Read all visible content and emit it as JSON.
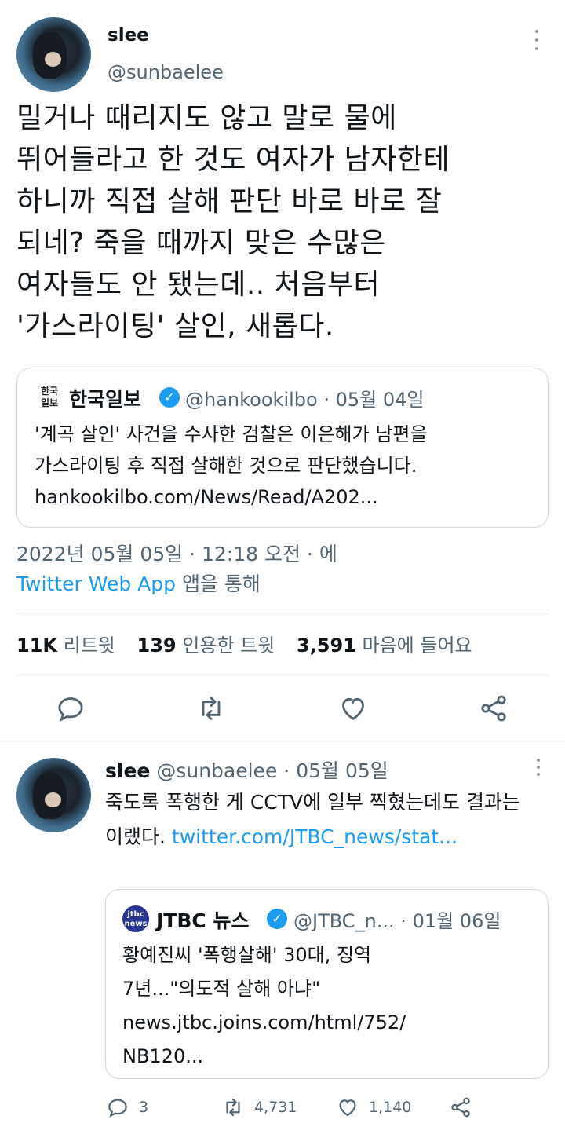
{
  "main_tweet": {
    "author_name": "slee",
    "author_handle": "@sunbaelee",
    "text": "밀거나 때리지도 않고 말로 물에\n뛰어들라고 한 것도 여자가 남자한테\n하니까 직접 살해 판단 바로 바로 잘\n되네? 죽을 때까지 맞은 수많은\n여자들도 안 됐는데.. 처음부터\n'가스라이팅' 살인, 새롭다.",
    "quoted": {
      "logo_text": "한국\n일보",
      "name": "한국일보",
      "handle": "@hankookilbo",
      "date": "05월 04일",
      "separator": "·",
      "text": "'계곡 살인' 사건을 수사한 검찰은 이은해가 남편을\n가스라이팅 후 직접 살해한 것으로 판단했습니다.\nhankookilbo.com/News/Read/A202..."
    },
    "timestamp": "2022년 05월 05일 · 12:18 오전 · 에",
    "source_link": "Twitter Web App",
    "source_suffix": " 앱을 통해",
    "stats": {
      "retweets_count": "11K",
      "retweets_label": "리트윗",
      "quotes_count": "139",
      "quotes_label": "인용한 트윗",
      "likes_count": "3,591",
      "likes_label": "마음에 들어요"
    }
  },
  "reply_tweet": {
    "author_name": "slee",
    "author_handle": "@sunbaelee",
    "separator": "·",
    "date": "05월 05일",
    "text": "죽도록 폭행한 게 CCTV에 일부 찍혔는데도 결과는 이랬다. ",
    "link": "twitter.com/JTBC_news/stat...",
    "quoted": {
      "logo_text": "jtbc news",
      "name": "JTBC 뉴스",
      "handle": "@JTBC_n...",
      "date": "01월 06일",
      "separator": "·",
      "text": "황예진씨 '폭행살해' 30대, 징역\n7년...\"의도적 살해 아냐\"\nnews.jtbc.joins.com/html/752/\nNB120..."
    },
    "counts": {
      "replies": "3",
      "retweets": "4,731",
      "likes": "1,140"
    }
  },
  "colors": {
    "accent": "#1d9bf0",
    "text_primary": "#0f1419",
    "text_secondary": "#536471",
    "border": "#cfd9de"
  },
  "icons": [
    "reply-icon",
    "retweet-icon",
    "like-icon",
    "share-icon",
    "more-icon",
    "verified-badge-icon"
  ]
}
